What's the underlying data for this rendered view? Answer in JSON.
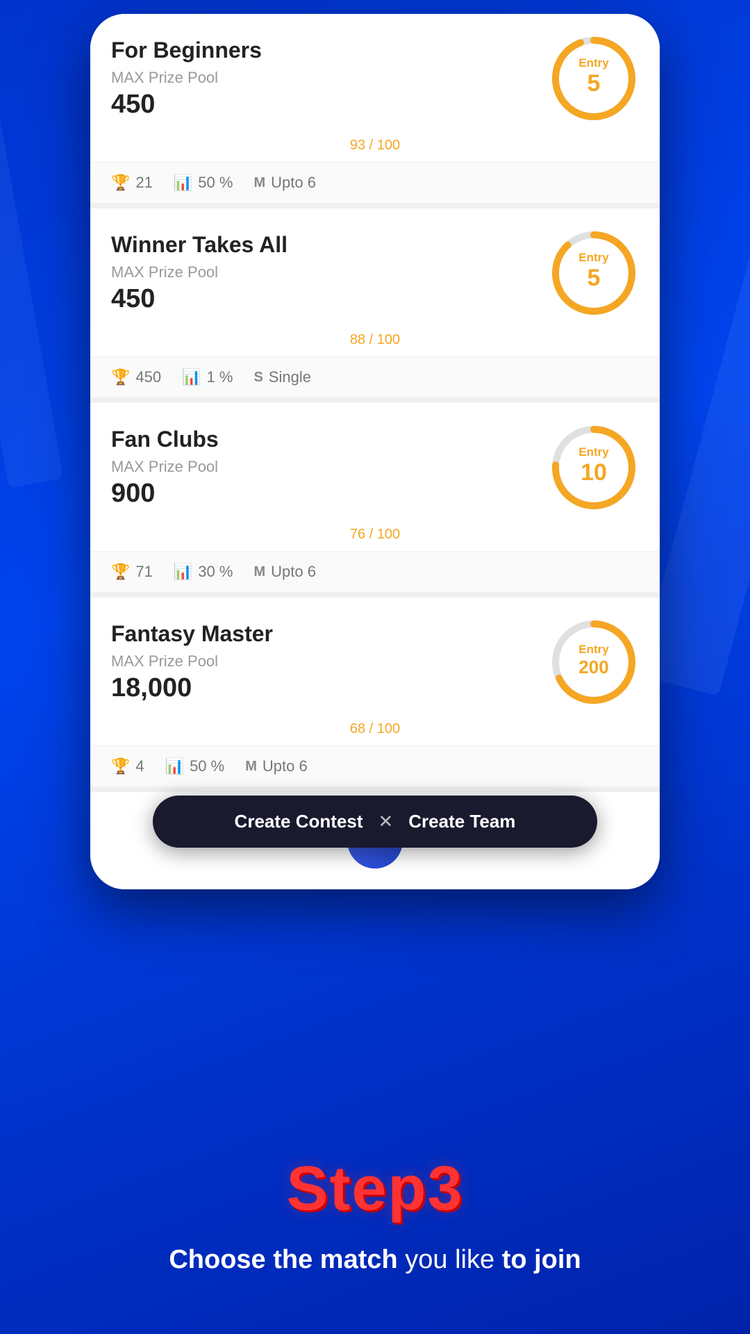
{
  "background": {
    "color_start": "#0033cc",
    "color_end": "#0022aa"
  },
  "contests": [
    {
      "id": "beginners",
      "title": "For Beginners",
      "prize_label": "MAX Prize Pool",
      "prize_value": "450",
      "entry": "5",
      "filled": "93",
      "total": "100",
      "donut_percent": 93,
      "stats": [
        {
          "icon": "🏆",
          "value": "21"
        },
        {
          "icon": "📊",
          "value": "50 %"
        },
        {
          "icon": "M",
          "value": "Upto 6"
        }
      ],
      "accent_color": "#f5a623"
    },
    {
      "id": "winner-takes-all",
      "title": "Winner Takes All",
      "prize_label": "MAX Prize Pool",
      "prize_value": "450",
      "entry": "5",
      "filled": "88",
      "total": "100",
      "donut_percent": 88,
      "stats": [
        {
          "icon": "🏆",
          "value": "450"
        },
        {
          "icon": "📊",
          "value": "1 %"
        },
        {
          "icon": "S",
          "value": "Single"
        }
      ],
      "accent_color": "#f5a623"
    },
    {
      "id": "fan-clubs",
      "title": "Fan Clubs",
      "prize_label": "MAX Prize Pool",
      "prize_value": "900",
      "entry": "10",
      "filled": "76",
      "total": "100",
      "donut_percent": 76,
      "stats": [
        {
          "icon": "🏆",
          "value": "71"
        },
        {
          "icon": "📊",
          "value": "30 %"
        },
        {
          "icon": "M",
          "value": "Upto 6"
        }
      ],
      "accent_color": "#f5a623"
    },
    {
      "id": "fantasy-master",
      "title": "Fantasy Master",
      "prize_label": "MAX Prize Pool",
      "prize_value": "18,000",
      "entry": "200",
      "filled": "68",
      "total": "100",
      "donut_percent": 68,
      "stats": [
        {
          "icon": "🏆",
          "value": "4"
        },
        {
          "icon": "📊",
          "value": "..."
        },
        {
          "icon": "M",
          "value": "..."
        }
      ],
      "accent_color": "#f5a623"
    }
  ],
  "action_bar": {
    "create_contest": "Create Contest",
    "divider": "✕",
    "create_team": "Create Team"
  },
  "step": {
    "label": "Step3",
    "description_bold": "Choose the match",
    "description_regular": " you like ",
    "description_bold2": "to join"
  }
}
